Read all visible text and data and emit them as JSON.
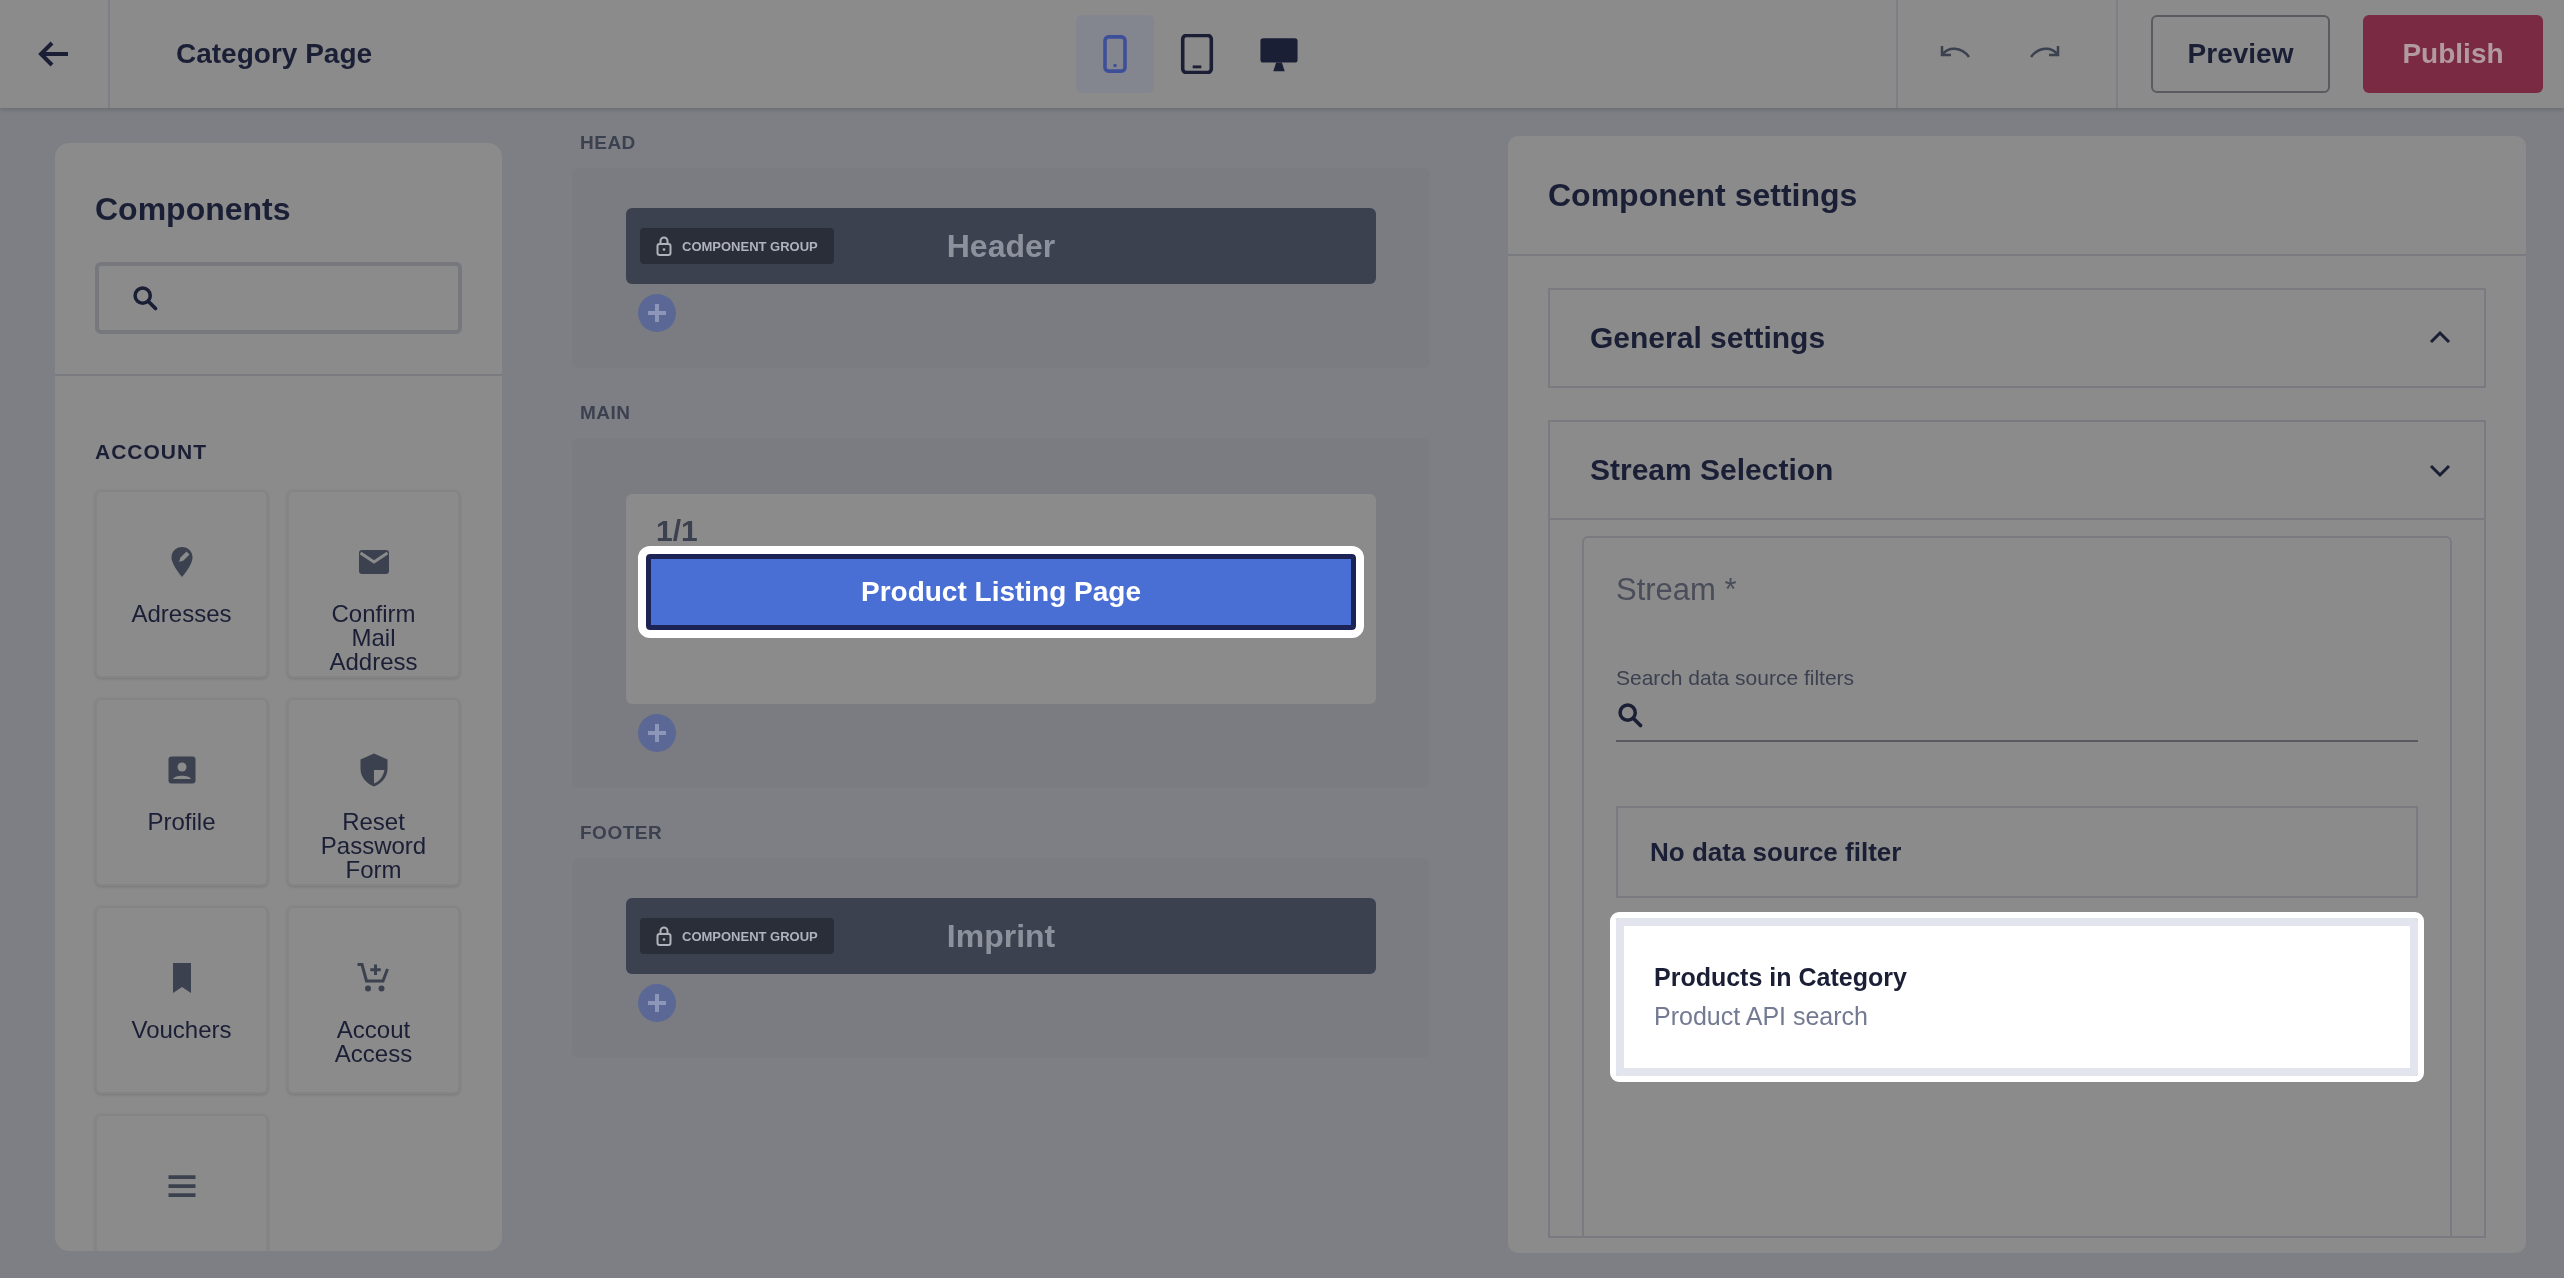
{
  "topbar": {
    "title": "Category Page",
    "devices": [
      {
        "kind": "phone",
        "selected": true
      },
      {
        "kind": "tablet",
        "selected": false
      },
      {
        "kind": "desktop",
        "selected": false
      }
    ],
    "buttons": [
      {
        "label": "Preview",
        "kind": "secondary"
      },
      {
        "label": "Publish",
        "kind": "primary"
      }
    ]
  },
  "components": {
    "title": "Components",
    "categories": [
      {
        "label": "ACCOUNT",
        "items": [
          {
            "label": "Adresses",
            "kind": "pin"
          },
          {
            "label": "Confirm Mail Address",
            "kind": "mail"
          },
          {
            "label": "Profile",
            "kind": "profile"
          },
          {
            "label": "Reset Password Form",
            "kind": "shield"
          },
          {
            "label": "Vouchers",
            "kind": "bookmark"
          },
          {
            "label": "Accout Access",
            "kind": "cart"
          },
          {
            "kind": "list"
          }
        ]
      }
    ]
  },
  "canvas": {
    "sections": [
      {
        "label": "HEAD",
        "blocks": [
          {
            "kind": "group",
            "badge": "COMPONENT GROUP",
            "label": "Header"
          }
        ]
      },
      {
        "label": "MAIN",
        "blocks": [
          {
            "kind": "row",
            "column_label": "1/1",
            "components": [
              {
                "label": "Product Listing Page",
                "selected": true
              }
            ]
          }
        ]
      },
      {
        "label": "FOOTER",
        "blocks": [
          {
            "kind": "group",
            "badge": "COMPONENT GROUP",
            "label": "Imprint"
          }
        ]
      }
    ]
  },
  "settings": {
    "title": "Component settings",
    "accordions": [
      {
        "title": "General settings",
        "expanded": true
      },
      {
        "title": "Stream Selection",
        "expanded": false,
        "field_label": "Stream *",
        "search_label": "Search data source filters",
        "options": [
          {
            "title": "No data source filter",
            "selected": false
          },
          {
            "title": "Products in Category",
            "subtitle": "Product API search",
            "selected": true
          }
        ]
      }
    ]
  }
}
